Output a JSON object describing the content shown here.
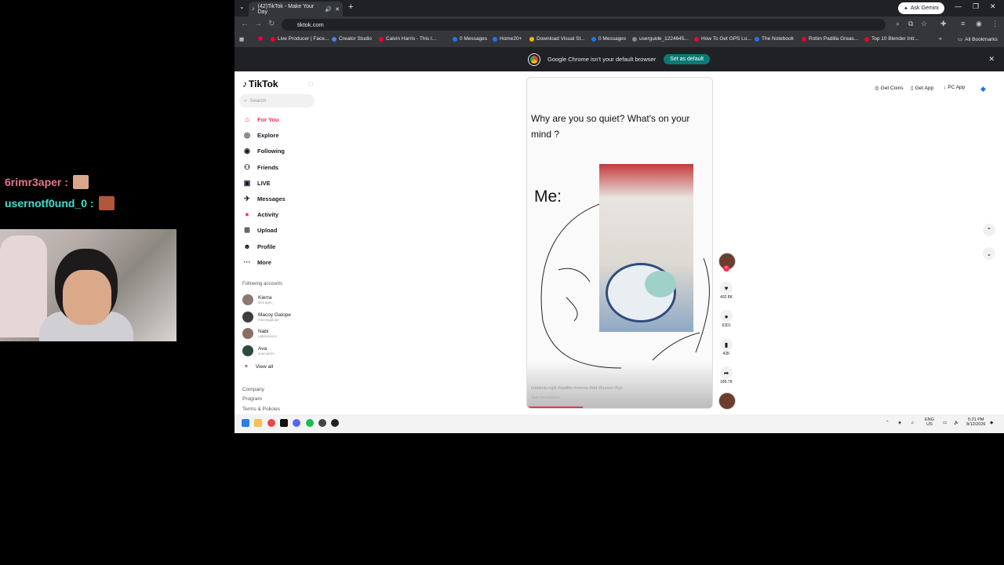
{
  "overlay": {
    "chat": [
      {
        "user": "6rimr3aper :",
        "color": "#e07a8a"
      },
      {
        "user": "usernotf0und_0 :",
        "color": "#3fe0d0"
      }
    ]
  },
  "browser": {
    "tab_title": "(42)TikTok - Make Your Day",
    "url": "tiktok.com",
    "ask_gemini": "Ask Gemini",
    "bookmarks": [
      "Live Producer | Face...",
      "Creator Studio",
      "Calvin Harris - This I...",
      "0 Messages",
      "Home20+",
      "Download Visual St...",
      "0 Messages",
      "userguide_1224645...",
      "How To Get GPS Lo...",
      "The Notebook",
      "Robin Padilla Greas...",
      "Top 10 Blender Intr..."
    ],
    "all_bookmarks": "All Bookmarks",
    "infobar_text": "Google Chrome isn't your default browser",
    "set_default": "Set as default"
  },
  "tiktok": {
    "logo": "TikTok",
    "search_placeholder": "Search",
    "nav": [
      {
        "label": "For You",
        "icon": "home-icon",
        "active": true
      },
      {
        "label": "Explore",
        "icon": "compass-icon"
      },
      {
        "label": "Following",
        "icon": "following-icon"
      },
      {
        "label": "Friends",
        "icon": "friends-icon"
      },
      {
        "label": "LIVE",
        "icon": "live-icon"
      },
      {
        "label": "Messages",
        "icon": "messages-icon"
      },
      {
        "label": "Activity",
        "icon": "activity-icon"
      },
      {
        "label": "Upload",
        "icon": "upload-icon"
      },
      {
        "label": "Profile",
        "icon": "profile-icon"
      },
      {
        "label": "More",
        "icon": "more-icon"
      }
    ],
    "following_label": "Following accounts",
    "accounts": [
      {
        "name": "Kierra",
        "handle": "kierragm_"
      },
      {
        "name": "Macoy Galope",
        "handle": "macoygalope"
      },
      {
        "name": "Nabi",
        "handle": "nabimarisss"
      },
      {
        "name": "Ava",
        "handle": "avacuervo"
      }
    ],
    "view_all": "View all",
    "footer": [
      "Company",
      "Program",
      "Terms & Policies"
    ],
    "topright": [
      "Get Coins",
      "Get App",
      "PC App"
    ],
    "video": {
      "question": "Why are you so quiet? What's on your mind ?",
      "me": "Me:",
      "caption": "matamis ngiti #sadlife #meme #kid #humor #fyp",
      "see_translation": "See translation",
      "progress": 0.3
    },
    "actions": [
      {
        "icon": "heart-icon",
        "count": "492.8K"
      },
      {
        "icon": "comment-icon",
        "count": "6301"
      },
      {
        "icon": "bookmark-icon",
        "count": "42K"
      },
      {
        "icon": "share-icon",
        "count": "185.7K"
      }
    ]
  },
  "taskbar": {
    "lang": "ENG",
    "region": "US",
    "time": "5:21 PM",
    "date": "8/12/2026"
  }
}
